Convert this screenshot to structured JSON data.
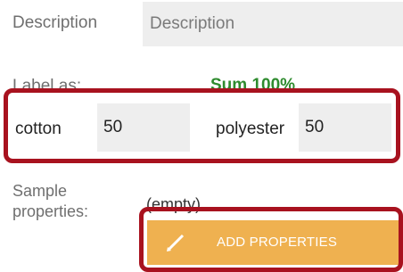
{
  "description": {
    "label": "Description",
    "placeholder": "Description",
    "value": ""
  },
  "label_as": {
    "label": "Label as:",
    "sum_text": "Sum 100%",
    "sum_color": "#2e8b2e"
  },
  "fibers": [
    {
      "name": "cotton",
      "value": "50"
    },
    {
      "name": "polyester",
      "value": "50"
    }
  ],
  "sample": {
    "label_line1": "Sample",
    "label_line2": "properties:",
    "value": "(empty)"
  },
  "add_button": {
    "label": "ADD PROPERTIES",
    "icon": "pencil-icon",
    "color": "#efb150"
  },
  "highlight_color": "#a8121f"
}
